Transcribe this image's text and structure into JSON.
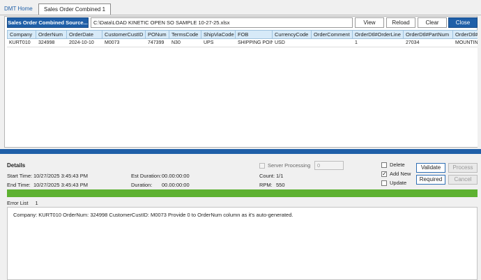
{
  "tabs": {
    "home": "DMT Home",
    "active": "Sales Order Combined 1"
  },
  "toolbar": {
    "source_button": "Sales Order Combined Source...",
    "file_path": "C:\\Data\\LOAD KINETIC OPEN SO SAMPLE 10-27-25.xlsx",
    "view": "View",
    "reload": "Reload",
    "clear": "Clear",
    "close": "Close"
  },
  "grid": {
    "columns": [
      "Company",
      "OrderNum",
      "OrderDate",
      "CustomerCustID",
      "PONum",
      "TermsCode",
      "ShipViaCode",
      "FOB",
      "CurrencyCode",
      "OrderComment",
      "OrderDtl#OrderLine",
      "OrderDtl#PartNum",
      "OrderDtl#Li"
    ],
    "rows": [
      [
        "KURT010",
        "324998",
        "2024-10-10",
        "M0073",
        "747399",
        "N30",
        "UPS",
        "SHIPPING POINT",
        "USD",
        "",
        "1",
        "27034",
        "MOUNTING FL"
      ]
    ]
  },
  "details": {
    "title": "Details",
    "start_time_label": "Start Time:",
    "start_time": "10/27/2025 3:45:43 PM",
    "end_time_label": "End Time:",
    "end_time": "10/27/2025 3:45:43 PM",
    "est_duration_label": "Est Duration:",
    "est_duration": "00.00:00:00",
    "duration_label": "Duration:",
    "duration": "00.00:00:00",
    "server_processing_label": "Server Processing",
    "server_processing_value": "0",
    "count_label": "Count:",
    "count": "1/1",
    "rpm_label": "RPM:",
    "rpm": "550",
    "delete_label": "Delete",
    "add_new_label": "Add New",
    "update_label": "Update",
    "validate": "Validate",
    "process": "Process",
    "required": "Required",
    "cancel": "Cancel",
    "progress_percent": 100
  },
  "errors": {
    "label": "Error List",
    "count": "1",
    "message": "Company: KURT010 OrderNum: 324998 CustomerCustID: M0073   Provide 0 to OrderNum column as it's auto-generated."
  },
  "colors": {
    "accent": "#1f5fa8",
    "header_bg": "#d7eaf8",
    "progress": "#5db131"
  }
}
